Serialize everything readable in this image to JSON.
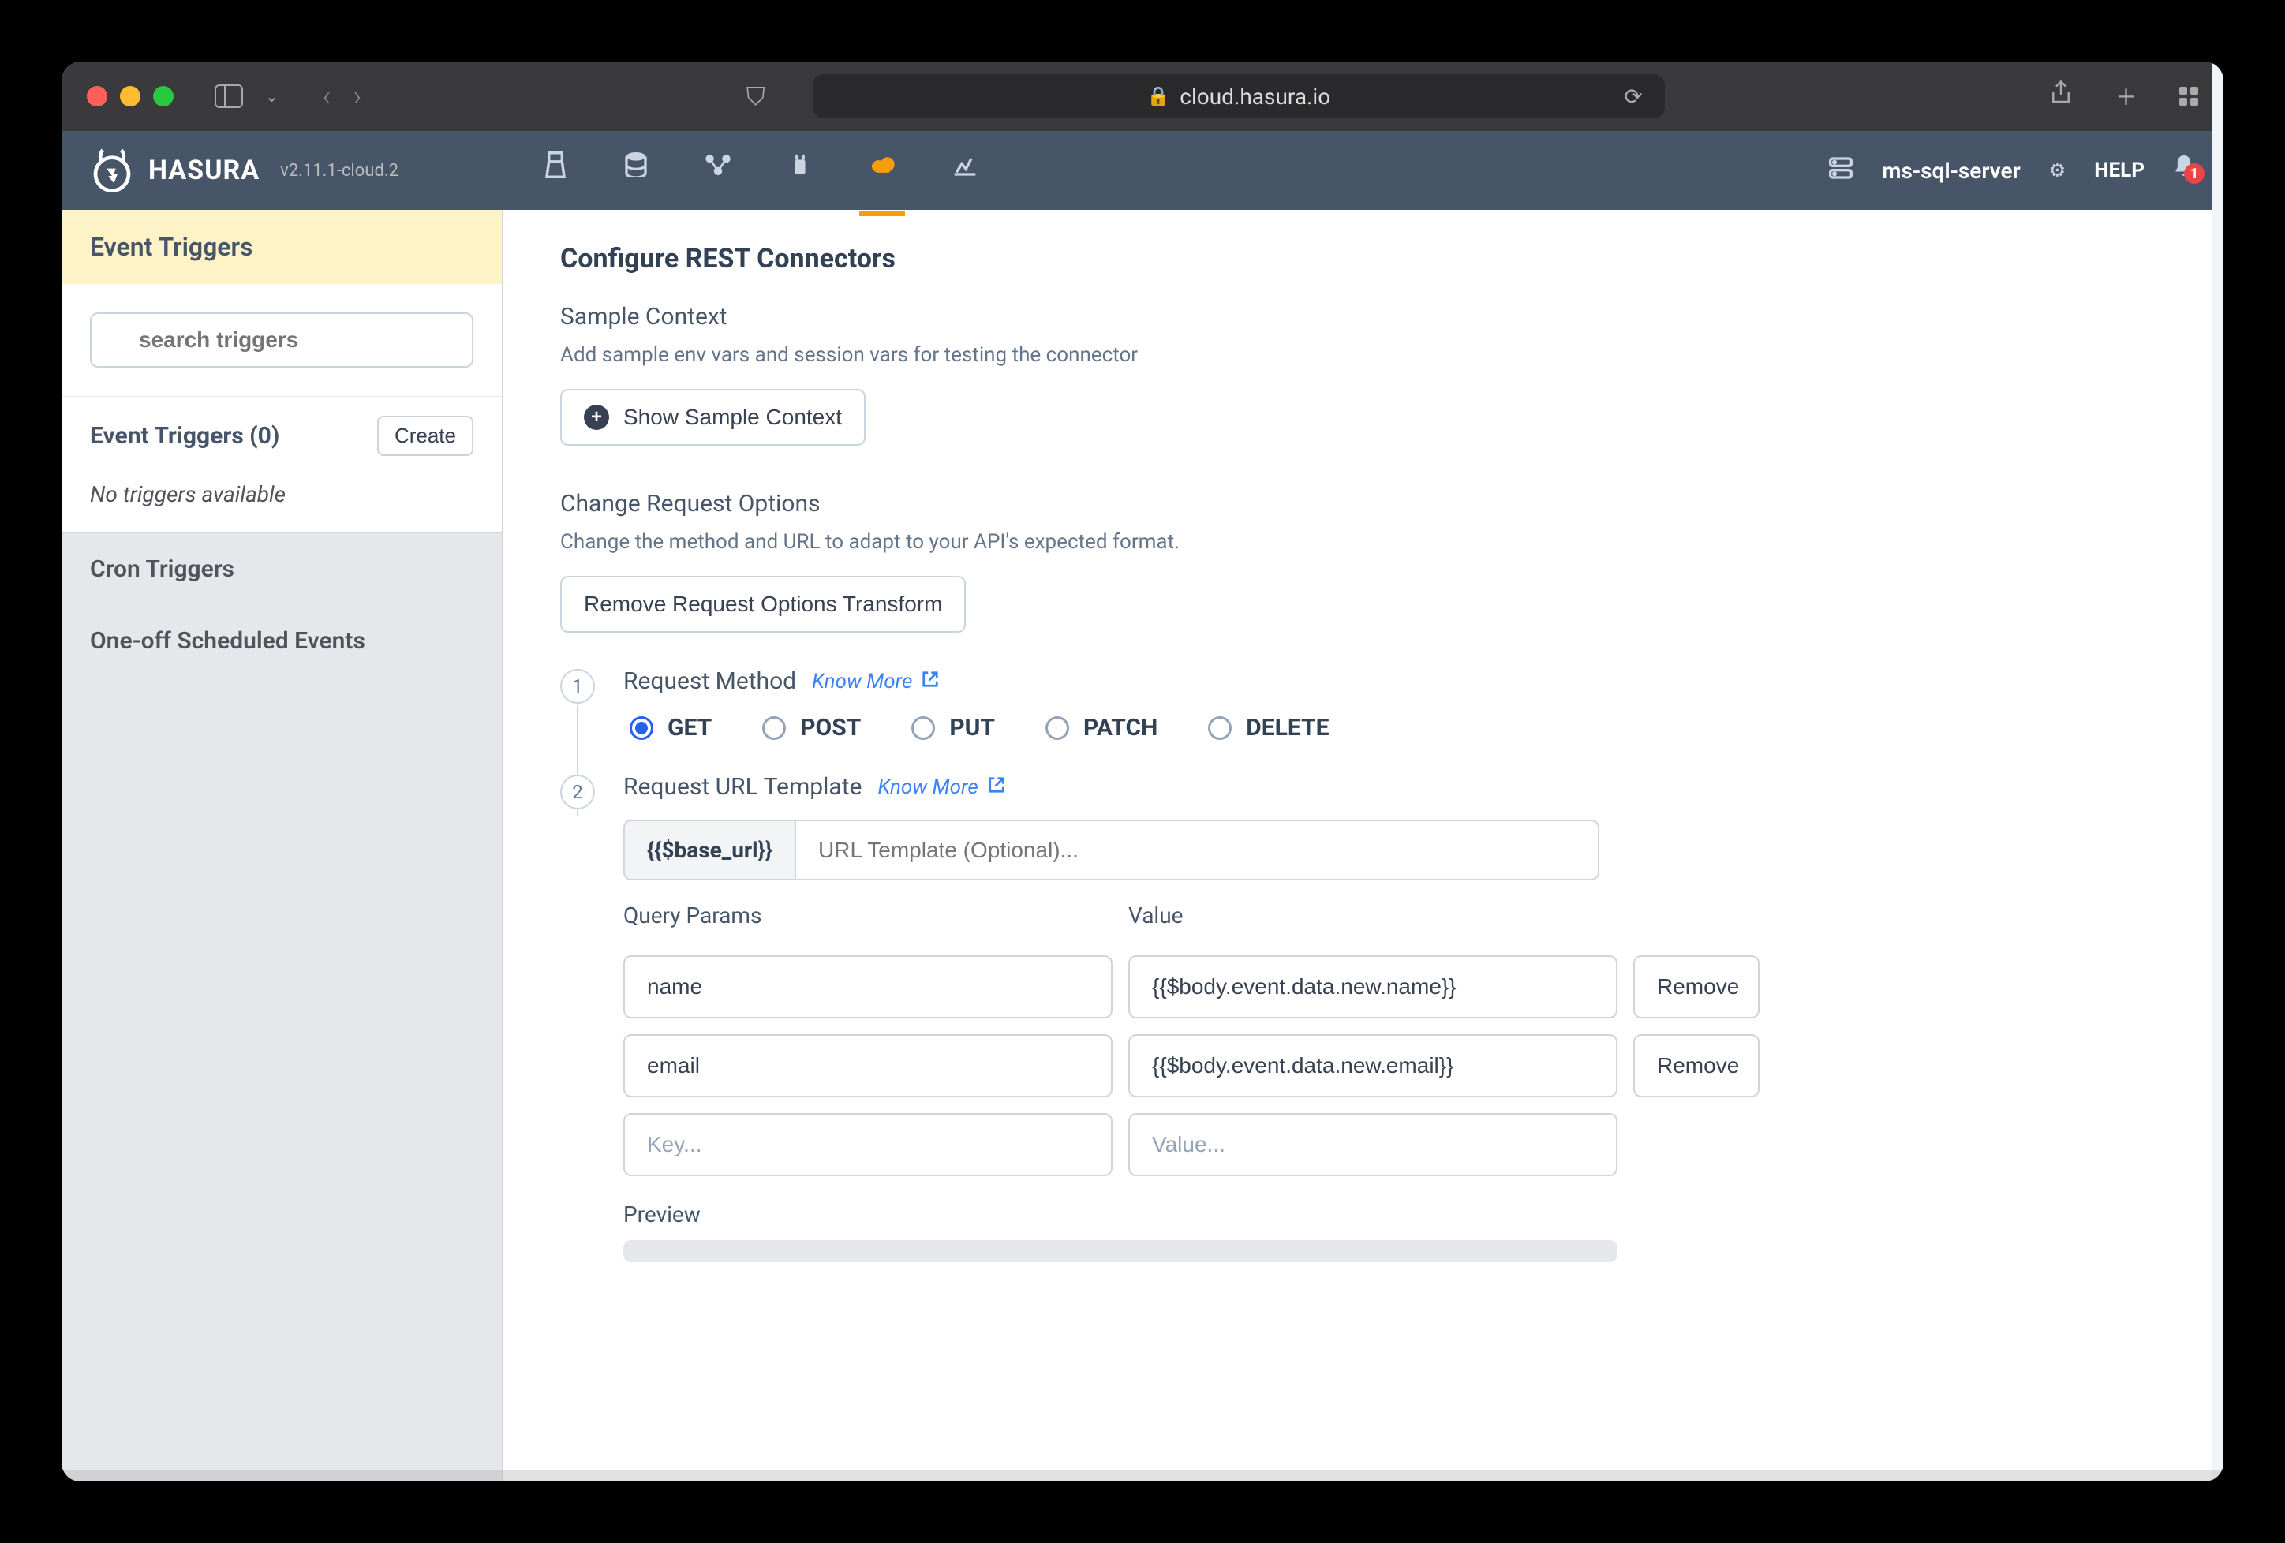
{
  "browser": {
    "url": "cloud.hasura.io"
  },
  "header": {
    "brand": "HASURA",
    "version": "v2.11.1-cloud.2",
    "db_name": "ms-sql-server",
    "help": "HELP",
    "notification_count": "1"
  },
  "sidebar": {
    "event_triggers": "Event Triggers",
    "search_placeholder": "search triggers",
    "triggers_count_label": "Event Triggers (0)",
    "create_label": "Create",
    "no_triggers": "No triggers available",
    "cron_triggers": "Cron Triggers",
    "one_off": "One-off Scheduled Events"
  },
  "content": {
    "title": "Configure REST Connectors",
    "sample_context": {
      "heading": "Sample Context",
      "desc": "Add sample env vars and session vars for testing the connector",
      "button": "Show Sample Context"
    },
    "change_request": {
      "heading": "Change Request Options",
      "desc": "Change the method and URL to adapt to your API's expected format.",
      "button": "Remove Request Options Transform"
    },
    "step1": {
      "num": "1",
      "title": "Request Method",
      "know_more": "Know More",
      "methods": [
        "GET",
        "POST",
        "PUT",
        "PATCH",
        "DELETE"
      ],
      "selected": "GET"
    },
    "step2": {
      "num": "2",
      "title": "Request URL Template",
      "know_more": "Know More",
      "prefix": "{{$base_url}}",
      "url_placeholder": "URL Template (Optional)...",
      "query_params_label": "Query Params",
      "value_label": "Value",
      "rows": [
        {
          "key": "name",
          "value": "{{$body.event.data.new.name}}",
          "remove": "Remove"
        },
        {
          "key": "email",
          "value": "{{$body.event.data.new.email}}",
          "remove": "Remove"
        }
      ],
      "key_placeholder": "Key...",
      "value_placeholder": "Value...",
      "preview_label": "Preview"
    }
  }
}
